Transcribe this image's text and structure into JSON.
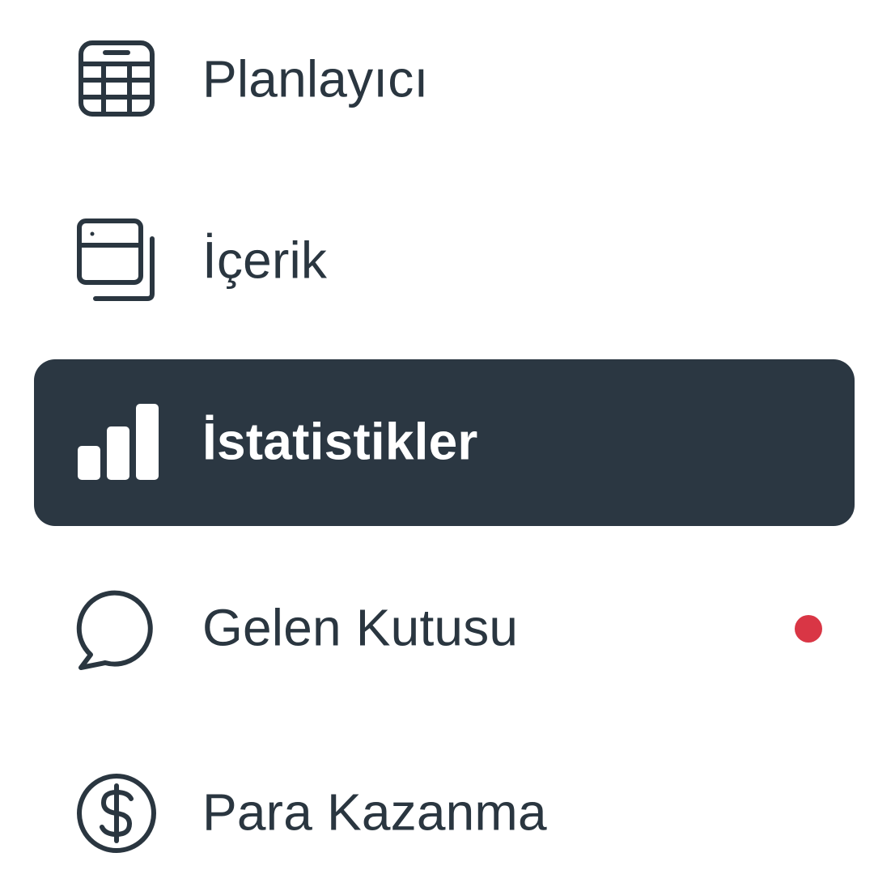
{
  "colors": {
    "text": "#2a3640",
    "active_background": "#2b3742",
    "active_text": "#ffffff",
    "badge": "#d93645"
  },
  "sidebar": {
    "items": [
      {
        "label": "Planlayıcı",
        "icon": "calendar-icon",
        "active": false
      },
      {
        "label": "İçerik",
        "icon": "content-stack-icon",
        "active": false
      },
      {
        "label": "İstatistikler",
        "icon": "bar-chart-icon",
        "active": true
      },
      {
        "label": "Gelen Kutusu",
        "icon": "chat-bubble-icon",
        "active": false,
        "has_notification": true
      },
      {
        "label": "Para Kazanma",
        "icon": "dollar-circle-icon",
        "active": false
      }
    ]
  }
}
